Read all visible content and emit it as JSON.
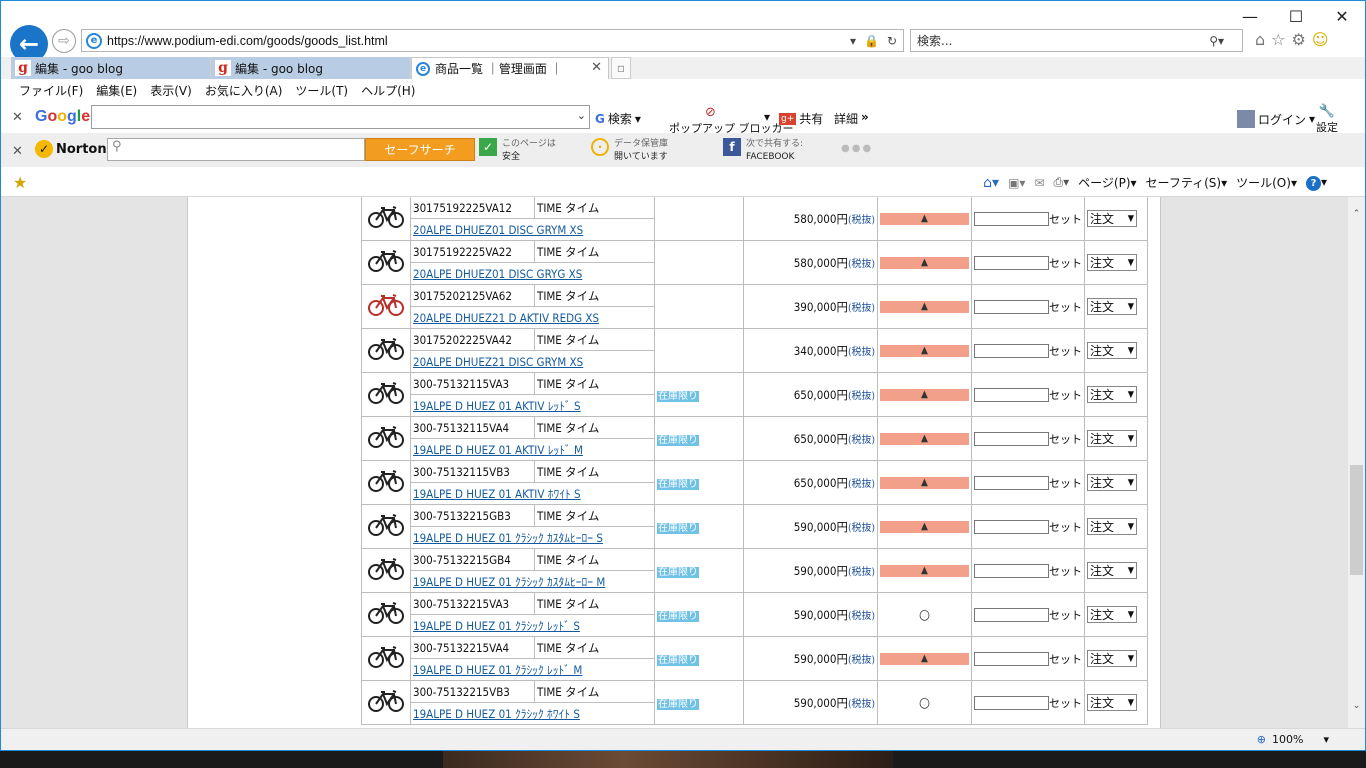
{
  "browser": {
    "url": "https://www.podium-edi.com/goods/goods_list.html",
    "search_placeholder": "検索...",
    "caption": {
      "minimize": "—",
      "maximize": "☐",
      "close": "✕"
    },
    "tabs": [
      {
        "label": "編集 - goo blog"
      },
      {
        "label": "編集 - goo blog"
      },
      {
        "label": "商品一覧 ｜管理画面 ｜"
      }
    ],
    "menu": [
      "ファイル(F)",
      "編集(E)",
      "表示(V)",
      "お気に入り(A)",
      "ツール(T)",
      "ヘルプ(H)"
    ],
    "google_toolbar": {
      "logo": "Google",
      "search_label": "検索",
      "popup_blocker": "ポップアップ ブロッカー",
      "share": "共有",
      "details": "詳細",
      "more": "»",
      "login": "ログイン",
      "settings": "設定"
    },
    "norton_toolbar": {
      "logo": "Norton",
      "search_button": "セーフサーチ",
      "safe_line1": "このページは",
      "safe_line2": "安全",
      "vault_line1": "データ保管庫",
      "vault_line2": "開いています",
      "share_line1": "次で共有する:",
      "share_line2": "FACEBOOK",
      "dots": "●●●"
    },
    "command_bar": {
      "page": "ページ(P)",
      "safety": "セーフティ(S)",
      "tools": "ツール(O)"
    },
    "zoom": "100%"
  },
  "products": [
    {
      "code": "30175192225VA12",
      "maker": "TIME タイム",
      "name": "20ALPE DHUEZ01 DISC GRYM XS",
      "stock": "",
      "price": "580,000円",
      "tax": "(税抜)",
      "avail": "▲",
      "unit": "セット",
      "order": "注文",
      "bike_color": "#222"
    },
    {
      "code": "30175192225VA22",
      "maker": "TIME タイム",
      "name": "20ALPE DHUEZ01 DISC GRYG XS",
      "stock": "",
      "price": "580,000円",
      "tax": "(税抜)",
      "avail": "▲",
      "unit": "セット",
      "order": "注文",
      "bike_color": "#222"
    },
    {
      "code": "30175202125VA62",
      "maker": "TIME タイム",
      "name": "20ALPE DHUEZ21 D AKTIV REDG XS",
      "stock": "",
      "price": "390,000円",
      "tax": "(税抜)",
      "avail": "▲",
      "unit": "セット",
      "order": "注文",
      "bike_color": "#b8302a"
    },
    {
      "code": "30175202225VA42",
      "maker": "TIME タイム",
      "name": "20ALPE DHUEZ21 DISC GRYM XS",
      "stock": "",
      "price": "340,000円",
      "tax": "(税抜)",
      "avail": "▲",
      "unit": "セット",
      "order": "注文",
      "bike_color": "#222"
    },
    {
      "code": "300-75132115VA3",
      "maker": "TIME タイム",
      "name": "19ALPE D HUEZ 01 AKTIV ﾚｯﾄﾞ S",
      "stock": "在庫限り",
      "price": "650,000円",
      "tax": "(税抜)",
      "avail": "▲",
      "unit": "セット",
      "order": "注文",
      "bike_color": "#222"
    },
    {
      "code": "300-75132115VA4",
      "maker": "TIME タイム",
      "name": "19ALPE D HUEZ 01 AKTIV ﾚｯﾄﾞ M",
      "stock": "在庫限り",
      "price": "650,000円",
      "tax": "(税抜)",
      "avail": "▲",
      "unit": "セット",
      "order": "注文",
      "bike_color": "#222"
    },
    {
      "code": "300-75132115VB3",
      "maker": "TIME タイム",
      "name": "19ALPE D HUEZ 01 AKTIV ﾎﾜｲﾄ S",
      "stock": "在庫限り",
      "price": "650,000円",
      "tax": "(税抜)",
      "avail": "▲",
      "unit": "セット",
      "order": "注文",
      "bike_color": "#222"
    },
    {
      "code": "300-75132215GB3",
      "maker": "TIME タイム",
      "name": "19ALPE D HUEZ 01 ｸﾗｼｯｸ ｶｽﾀﾑﾋｰﾛｰ S",
      "stock": "在庫限り",
      "price": "590,000円",
      "tax": "(税抜)",
      "avail": "▲",
      "unit": "セット",
      "order": "注文",
      "bike_color": "#222"
    },
    {
      "code": "300-75132215GB4",
      "maker": "TIME タイム",
      "name": "19ALPE D HUEZ 01 ｸﾗｼｯｸ ｶｽﾀﾑﾋｰﾛｰ M",
      "stock": "在庫限り",
      "price": "590,000円",
      "tax": "(税抜)",
      "avail": "▲",
      "unit": "セット",
      "order": "注文",
      "bike_color": "#222"
    },
    {
      "code": "300-75132215VA3",
      "maker": "TIME タイム",
      "name": "19ALPE D HUEZ 01 ｸﾗｼｯｸ ﾚｯﾄﾞ S",
      "stock": "在庫限り",
      "price": "590,000円",
      "tax": "(税抜)",
      "avail": "○",
      "unit": "セット",
      "order": "注文",
      "bike_color": "#222"
    },
    {
      "code": "300-75132215VA4",
      "maker": "TIME タイム",
      "name": "19ALPE D HUEZ 01 ｸﾗｼｯｸ ﾚｯﾄﾞ M",
      "stock": "在庫限り",
      "price": "590,000円",
      "tax": "(税抜)",
      "avail": "▲",
      "unit": "セット",
      "order": "注文",
      "bike_color": "#222"
    },
    {
      "code": "300-75132215VB3",
      "maker": "TIME タイム",
      "name": "19ALPE D HUEZ 01 ｸﾗｼｯｸ ﾎﾜｲﾄ S",
      "stock": "在庫限り",
      "price": "590,000円",
      "tax": "(税抜)",
      "avail": "○",
      "unit": "セット",
      "order": "注文",
      "bike_color": "#222"
    }
  ]
}
